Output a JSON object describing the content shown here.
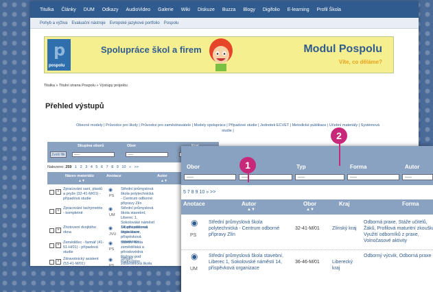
{
  "nav": {
    "top": [
      "Titulka",
      "Články",
      "DUM",
      "Odkazy",
      "AudioVideo",
      "Galerie",
      "Wiki",
      "Diskuze",
      "Buzza",
      "Blogy",
      "Digifolio",
      "E-learning",
      "Profil Škola"
    ],
    "sub": [
      "Pohyb a výživa",
      "Evaluační nástroje",
      "Evropské jazykové portfolio",
      "Pospolu"
    ]
  },
  "banner": {
    "logo_text": "pospolu",
    "title": "Spolupráce škol a firem",
    "module": "Modul Pospolu",
    "tagline": "Víte, co děláme?"
  },
  "breadcrumb": "Titulka » Titulní strana Pospolu » Výstupy projektu",
  "page_title": "Přehled výstupů",
  "category_links": "Obecné modely | Průvodce pro školy | Průvodce pro zaměstnavatele | Modely spolupráce | Případové studie | Jednotek ECVET | Metodické publikace | Učební materiály | Systémová studie |",
  "filter": {
    "submit": "Zvolit filtr",
    "labels": [
      "Skupina oborů",
      "Obor",
      "Kraj"
    ],
    "select_value": "-----"
  },
  "results": {
    "count_label": "Nalezeno:",
    "count": "259",
    "pages": [
      "1",
      "2",
      "3",
      "4",
      "5",
      "6",
      "7",
      "8",
      "9",
      "10",
      "»",
      ">>"
    ]
  },
  "list": {
    "headers": [
      "Název materiálu",
      "Anotace",
      "Autor"
    ],
    "sort": "▲▼",
    "rows": [
      {
        "name": "Zpracování saní, plastů a pryže (32-41-M/01) - případová studie",
        "code": "PS",
        "author": "Střední průmyslová škola polytechnická - Centrum odborné přípravy Zlín"
      },
      {
        "name": "Zpracování tachymetrie - kompletně",
        "code": "UM",
        "author": "Střední průmyslová škola stavební, Liberec 1, Sokolovské náměstí 14, příspěvková organizace"
      },
      {
        "name": "Zhotovení dvojitého okna",
        "code": "JVU",
        "author": "Střední odborná škola Hamr, příspěvková organizace"
      },
      {
        "name": "Zemědělec - farmář (41-51-H/01) - případová studie",
        "code": "PS",
        "author": "Střední škola zemědělská a přírodovědná Rožnov pod Radhoštěm"
      },
      {
        "name": "Zdravotnický asistent (53-41-M/01)",
        "code": "PS",
        "author": "Střední zdravotnická škola"
      }
    ]
  },
  "zoom": {
    "filter_labels": [
      "Obor",
      "Typ",
      "Forma",
      "Autor"
    ],
    "select_value": "-----",
    "pager": [
      "5",
      "7",
      "8",
      "9",
      "10",
      "»",
      ">>"
    ],
    "headers": [
      "Anotace",
      "Autor",
      "Obor",
      "Kraj",
      "Forma"
    ],
    "sort": "▲▼",
    "rows": [
      {
        "code": "PS",
        "author": "Střední průmyslová škola polytechnická - Centrum odborné přípravy Zlín",
        "obor": "32-41-M/01",
        "kraj": "Zlínský kraj",
        "forma": "Odborná praxe, Stáže učitelů, Žáků, Profilová maturitní zkouška, Využití odborníků z praxe, Volnočasové aktivity"
      },
      {
        "code": "UM",
        "author": "Střední průmyslová škola stavební, Liberec 1, Sokolovské náměstí 14, příspěvková organizace",
        "obor": "36-46-M/01",
        "kraj": "Liberecký kraj",
        "forma": "Odborný výcvik, Odborná praxe"
      }
    ]
  },
  "callouts": [
    "1",
    "2"
  ],
  "colors": {
    "nav": "#2f5b8f",
    "filter": "#8aa2c2",
    "banner": "#f6ef90",
    "callout": "#c8287a",
    "background": "#4a6a98"
  }
}
